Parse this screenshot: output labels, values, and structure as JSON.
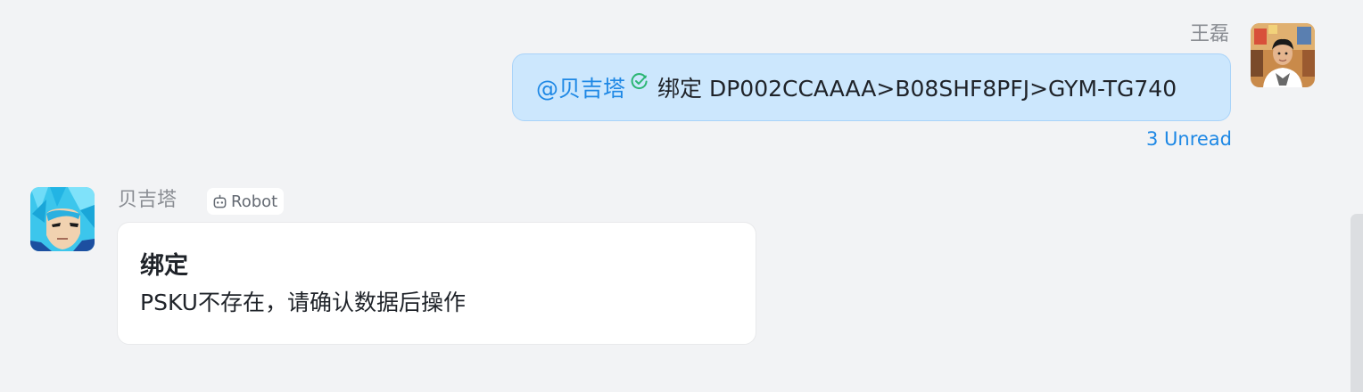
{
  "outgoing": {
    "sender_name": "王磊",
    "mention": "@贝吉塔",
    "text": "绑定 DP002CCAAAA>B08SHF8PFJ>GYM-TG740",
    "read_status": "3 Unread",
    "check_icon": "check-circle-icon"
  },
  "incoming": {
    "sender_name": "贝吉塔",
    "tag_label": "Robot",
    "tag_icon": "robot-icon",
    "card": {
      "title": "绑定",
      "body": "PSKU不存在，请确认数据后操作"
    }
  },
  "colors": {
    "background": "#f2f3f5",
    "outgoing_bubble": "#cce7fd",
    "mention": "#1e88e5",
    "unread": "#1e88e5",
    "check": "#2bb673"
  }
}
